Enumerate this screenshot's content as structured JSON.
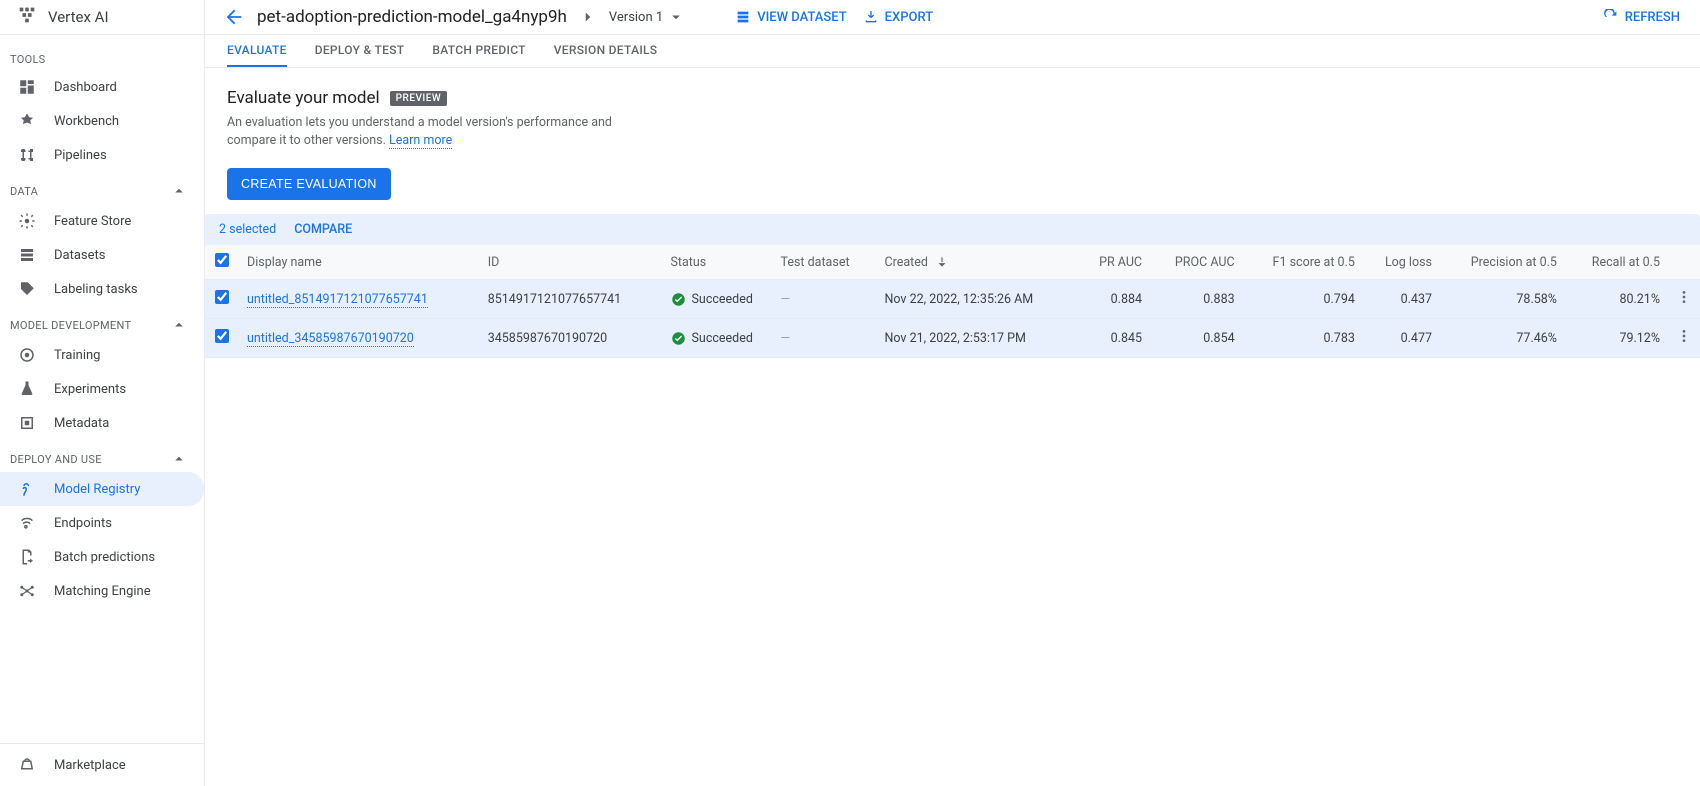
{
  "product": "Vertex AI",
  "sidebar": {
    "sections": [
      {
        "label": "TOOLS",
        "collapsible": false,
        "items": [
          {
            "icon": "dashboard",
            "label": "Dashboard"
          },
          {
            "icon": "workbench",
            "label": "Workbench"
          },
          {
            "icon": "pipelines",
            "label": "Pipelines"
          }
        ]
      },
      {
        "label": "DATA",
        "collapsible": true,
        "items": [
          {
            "icon": "feature-store",
            "label": "Feature Store"
          },
          {
            "icon": "datasets",
            "label": "Datasets"
          },
          {
            "icon": "labeling",
            "label": "Labeling tasks"
          }
        ]
      },
      {
        "label": "MODEL DEVELOPMENT",
        "collapsible": true,
        "items": [
          {
            "icon": "training",
            "label": "Training"
          },
          {
            "icon": "experiments",
            "label": "Experiments"
          },
          {
            "icon": "metadata",
            "label": "Metadata"
          }
        ]
      },
      {
        "label": "DEPLOY AND USE",
        "collapsible": true,
        "items": [
          {
            "icon": "model-registry",
            "label": "Model Registry",
            "active": true
          },
          {
            "icon": "endpoints",
            "label": "Endpoints"
          },
          {
            "icon": "batch-predictions",
            "label": "Batch predictions"
          },
          {
            "icon": "matching-engine",
            "label": "Matching Engine"
          }
        ]
      }
    ],
    "footer": {
      "icon": "marketplace",
      "label": "Marketplace"
    }
  },
  "header": {
    "model_name": "pet-adoption-prediction-model_ga4nyp9h",
    "version": "Version 1",
    "view_dataset": "VIEW DATASET",
    "export": "EXPORT",
    "refresh": "REFRESH"
  },
  "tabs": {
    "items": [
      {
        "label": "EVALUATE",
        "active": true
      },
      {
        "label": "DEPLOY & TEST"
      },
      {
        "label": "BATCH PREDICT"
      },
      {
        "label": "VERSION DETAILS"
      }
    ]
  },
  "evaluate": {
    "title": "Evaluate your model",
    "badge": "PREVIEW",
    "desc": "An evaluation lets you understand a model version's performance and compare it to other versions. ",
    "learn_more": "Learn more",
    "create_button": "CREATE EVALUATION"
  },
  "selection": {
    "count_text": "2 selected",
    "compare": "COMPARE"
  },
  "table": {
    "columns": {
      "display_name": "Display name",
      "id": "ID",
      "status": "Status",
      "test_dataset": "Test dataset",
      "created": "Created",
      "pr_auc": "PR AUC",
      "proc_auc": "PROC AUC",
      "f1": "F1 score at 0.5",
      "log_loss": "Log loss",
      "precision": "Precision at 0.5",
      "recall": "Recall at 0.5"
    },
    "rows": [
      {
        "checked": true,
        "display_name": "untitled_8514917121077657741",
        "id": "8514917121077657741",
        "status": "Succeeded",
        "test_dataset": "—",
        "created": "Nov 22, 2022, 12:35:26 AM",
        "pr_auc": "0.884",
        "proc_auc": "0.883",
        "f1": "0.794",
        "log_loss": "0.437",
        "precision": "78.58%",
        "recall": "80.21%"
      },
      {
        "checked": true,
        "display_name": "untitled_34585987670190720",
        "id": "34585987670190720",
        "status": "Succeeded",
        "test_dataset": "—",
        "created": "Nov 21, 2022, 2:53:17 PM",
        "pr_auc": "0.845",
        "proc_auc": "0.854",
        "f1": "0.783",
        "log_loss": "0.477",
        "precision": "77.46%",
        "recall": "79.12%"
      }
    ]
  }
}
